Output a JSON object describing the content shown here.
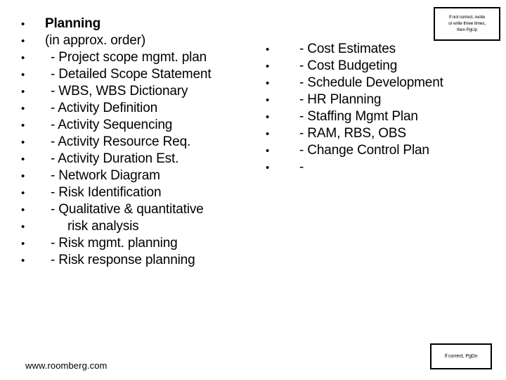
{
  "slide": {
    "title": "Planning",
    "footer_url": "www.roomberg.com"
  },
  "left_column": {
    "items": [
      {
        "bullet": "•",
        "text": "Planning",
        "style": "bold",
        "indent": 1
      },
      {
        "bullet": "•",
        "text": "(in approx. order)",
        "style": "plain",
        "indent": 1
      },
      {
        "bullet": "•",
        "text": "- Project scope mgmt. plan",
        "style": "plain",
        "indent": 2
      },
      {
        "bullet": "•",
        "text": "- Detailed Scope Statement",
        "style": "plain",
        "indent": 2
      },
      {
        "bullet": "•",
        "text": "- WBS, WBS Dictionary",
        "style": "plain",
        "indent": 2
      },
      {
        "bullet": "•",
        "text": "- Activity Definition",
        "style": "plain",
        "indent": 2
      },
      {
        "bullet": "•",
        "text": "- Activity Sequencing",
        "style": "plain",
        "indent": 2
      },
      {
        "bullet": "•",
        "text": "- Activity Resource Req.",
        "style": "plain",
        "indent": 2
      },
      {
        "bullet": "•",
        "text": "- Activity Duration Est.",
        "style": "plain",
        "indent": 2
      },
      {
        "bullet": "•",
        "text": "- Network Diagram",
        "style": "plain",
        "indent": 2
      },
      {
        "bullet": "•",
        "text": "- Risk Identification",
        "style": "plain",
        "indent": 2
      },
      {
        "bullet": "•",
        "text": "- Qualitative & quantitative",
        "style": "plain",
        "indent": 2
      },
      {
        "bullet": "•",
        "text": "risk analysis",
        "style": "plain",
        "indent": 3
      },
      {
        "bullet": "•",
        "text": "- Risk mgmt. planning",
        "style": "plain",
        "indent": 2
      },
      {
        "bullet": "•",
        "text": "- Risk response planning",
        "style": "plain",
        "indent": 2
      }
    ]
  },
  "right_column": {
    "items": [
      {
        "bullet": "•",
        "text": "- Cost Estimates",
        "style": "plain",
        "indent": 2
      },
      {
        "bullet": "•",
        "text": "- Cost Budgeting",
        "style": "plain",
        "indent": 2
      },
      {
        "bullet": "•",
        "text": "- Schedule Development",
        "style": "plain",
        "indent": 2
      },
      {
        "bullet": "•",
        "text": "- HR Planning",
        "style": "plain",
        "indent": 2
      },
      {
        "bullet": "•",
        "text": "- Staffing Mgmt Plan",
        "style": "plain",
        "indent": 2
      },
      {
        "bullet": "•",
        "text": "- RAM, RBS, OBS",
        "style": "plain",
        "indent": 2
      },
      {
        "bullet": "•",
        "text": "- Change Control Plan",
        "style": "plain",
        "indent": 2
      },
      {
        "bullet": "•",
        "text": "-",
        "style": "plain",
        "indent": 2
      }
    ]
  },
  "note_box_top": {
    "lines": [
      "If not correct, recite",
      "or write three times,",
      "then PgUp"
    ]
  },
  "note_box_bottom": {
    "lines": [
      "If correct, PgDn"
    ]
  }
}
